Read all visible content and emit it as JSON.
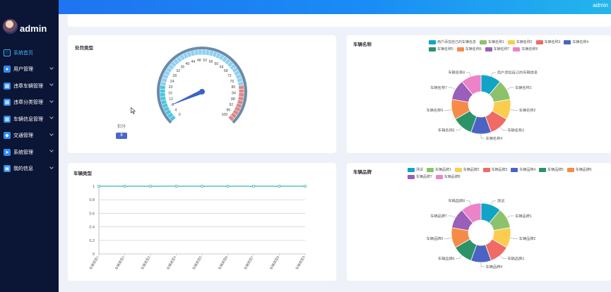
{
  "header": {
    "user": "admin"
  },
  "sidebar": {
    "title": "admin",
    "items": [
      {
        "label": "系统首页",
        "icon": "home-icon",
        "active": true
      },
      {
        "label": "用户管理",
        "icon": "user-icon"
      },
      {
        "label": "违章车辆管理",
        "icon": "grid-icon"
      },
      {
        "label": "违章分类管理",
        "icon": "grid-icon"
      },
      {
        "label": "车辆信息管理",
        "icon": "grid-icon"
      },
      {
        "label": "交通管理",
        "icon": "shield-icon"
      },
      {
        "label": "系统管理",
        "icon": "send-icon"
      },
      {
        "label": "我的信息",
        "icon": "profile-icon"
      }
    ]
  },
  "cards": {
    "gauge": {
      "title": "处罚类型",
      "score_label": "扣分",
      "score_value": "8"
    },
    "pie1": {
      "title": "车辆名称"
    },
    "line": {
      "title": "车辆类型"
    },
    "pie2": {
      "title": "车辆品牌"
    }
  },
  "chart_data": [
    {
      "type": "gauge",
      "title": "处罚类型",
      "value": 8,
      "range": [
        0,
        100
      ],
      "ticks": [
        "0",
        "4",
        "8",
        "12",
        "16",
        "20",
        "24",
        "28",
        "32",
        "36",
        "40",
        "44",
        "48",
        "52",
        "56",
        "60",
        "64",
        "68",
        "72",
        "76",
        "80",
        "84",
        "88",
        "92",
        "96",
        "100"
      ],
      "label": "扣分",
      "colors": {
        "low": "#4ec3e0",
        "mid": "#4a9fe0",
        "high": "#d9898a",
        "pointer": "#3b62c7"
      }
    },
    {
      "type": "pie",
      "title": "车辆名称",
      "donut": true,
      "labels": [
        "用户添加自己的车辆信息",
        "车辆名称1",
        "车辆名称2",
        "车辆名称3",
        "车辆名称4",
        "车辆名称5",
        "车辆名称6",
        "车辆名称7",
        "车辆名称8"
      ],
      "values": [
        1,
        1,
        1,
        1,
        1,
        1,
        1,
        1,
        1
      ],
      "colors": [
        "#11a4c7",
        "#8dc26b",
        "#fbcd4f",
        "#f06b65",
        "#4b64c3",
        "#2c9268",
        "#f68b48",
        "#9a5fb8",
        "#ec83c8"
      ]
    },
    {
      "type": "line",
      "title": "车辆类型",
      "categories": [
        "车辆类型1",
        "车辆类型2",
        "车辆类型3",
        "车辆类型4",
        "车辆类型5",
        "车辆类型6",
        "车辆类型7",
        "车辆类型8",
        "车辆类型9"
      ],
      "values": [
        1,
        1,
        1,
        1,
        1,
        1,
        1,
        1,
        1
      ],
      "ylim": [
        0,
        1
      ],
      "yticks": [
        "0",
        "0.2",
        "0.4",
        "0.6",
        "0.8",
        "1"
      ],
      "grid": true,
      "color": "#35b7b0"
    },
    {
      "type": "pie",
      "title": "车辆品牌",
      "donut": true,
      "labels": [
        "测试",
        "车辆品牌1",
        "车辆品牌2",
        "车辆品牌3",
        "车辆品牌4",
        "车辆品牌5",
        "车辆品牌6",
        "车辆品牌7",
        "车辆品牌8"
      ],
      "values": [
        1,
        1,
        1,
        1,
        1,
        1,
        1,
        1,
        1
      ],
      "colors": [
        "#11a4c7",
        "#8dc26b",
        "#fbcd4f",
        "#f06b65",
        "#4b64c3",
        "#2c9268",
        "#f68b48",
        "#9a5fb8",
        "#ec83c8"
      ]
    }
  ]
}
